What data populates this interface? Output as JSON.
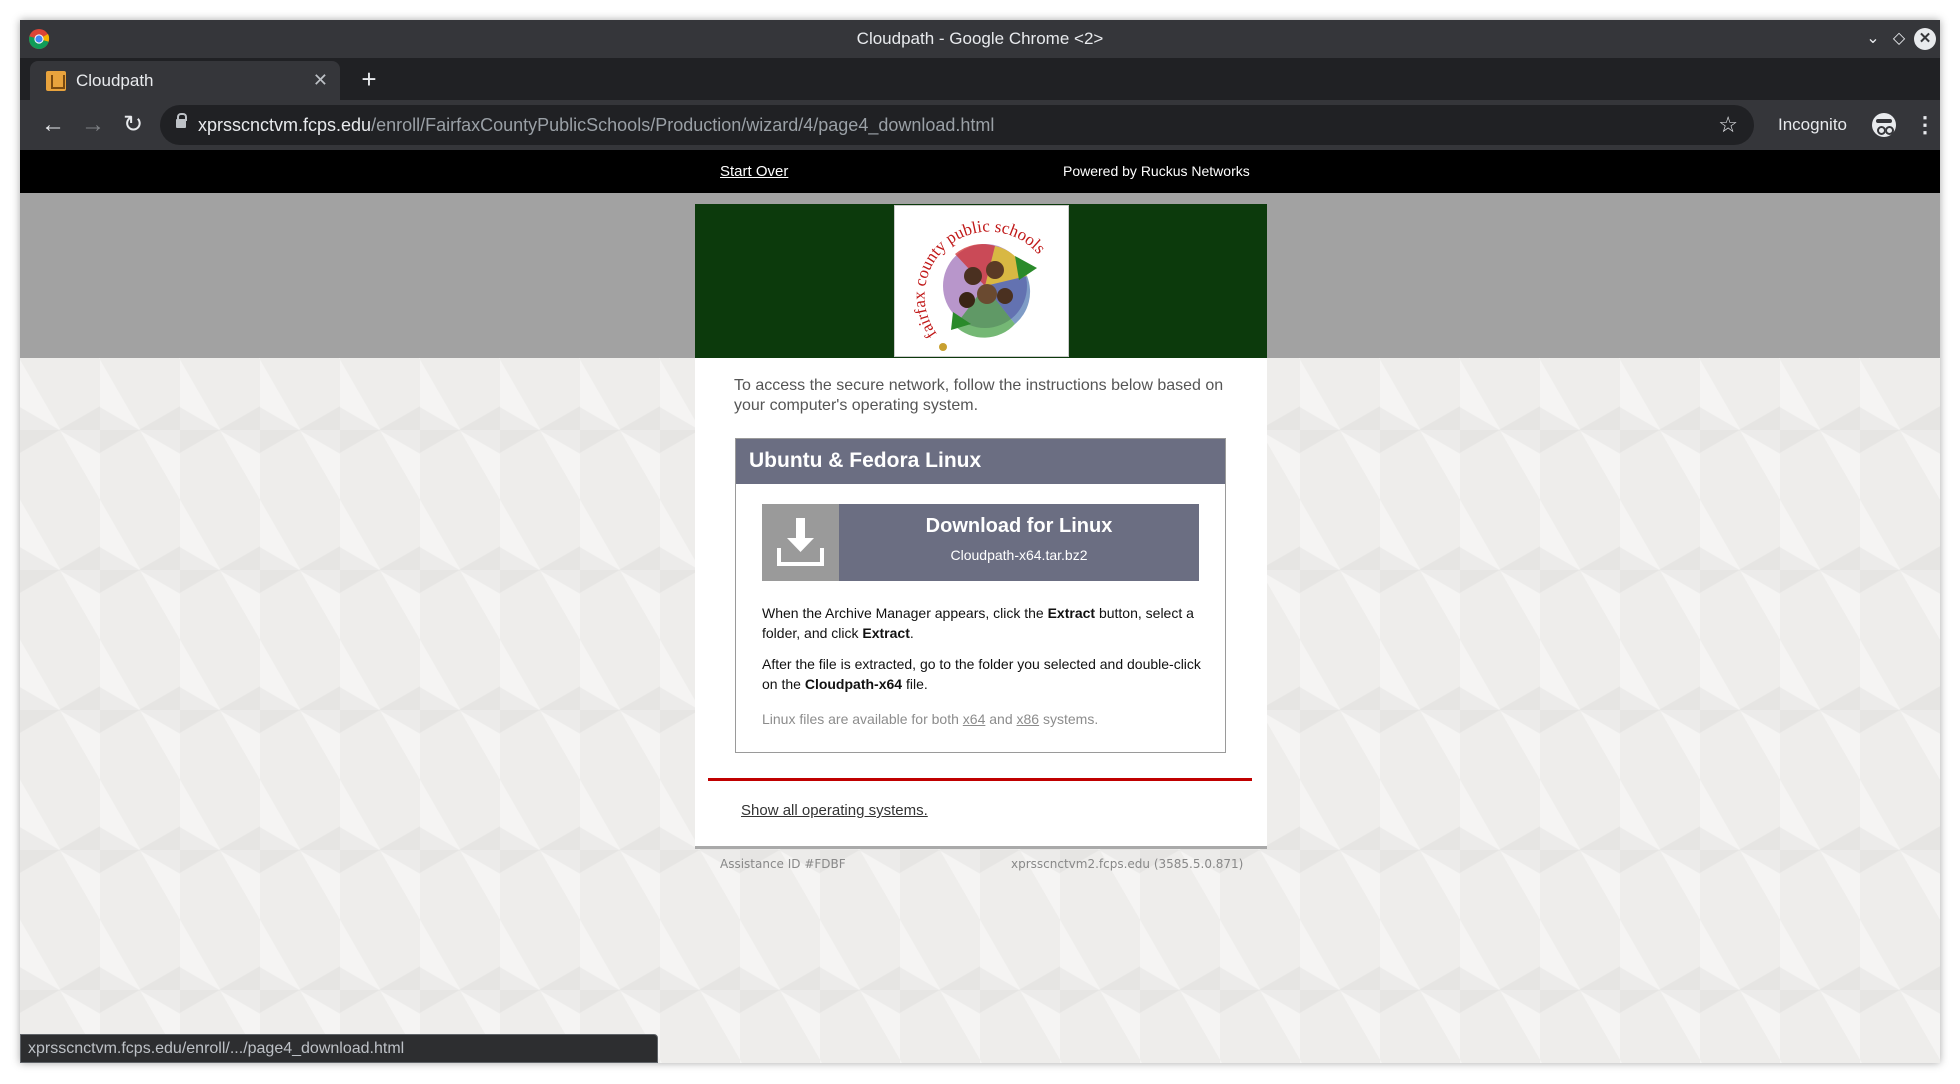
{
  "window": {
    "title": "Cloudpath - Google Chrome <2>"
  },
  "tab": {
    "title": "Cloudpath",
    "close_glyph": "✕",
    "new_tab_glyph": "+"
  },
  "toolbar": {
    "back_glyph": "←",
    "forward_glyph": "→",
    "reload_glyph": "↻",
    "url_host": "xprsscnctvm.fcps.edu",
    "url_path": "/enroll/FairfaxCountyPublicSchools/Production/wizard/4/page4_download.html",
    "star_glyph": "☆",
    "incognito_label": "Incognito",
    "menu_glyph": "⋮"
  },
  "topbar": {
    "start_over": "Start Over",
    "powered_by": "Powered by Ruckus Networks"
  },
  "content": {
    "intro": "To access the secure network, follow the instructions below based on your computer's operating system.",
    "os_title": "Ubuntu & Fedora Linux",
    "download_label": "Download for Linux",
    "download_file": "Cloudpath-x64.tar.bz2",
    "instr1_a": "When the Archive Manager appears, click the ",
    "instr1_b": "Extract",
    "instr1_c": " button, select a folder, and click ",
    "instr1_d": "Extract",
    "instr1_e": ".",
    "instr2_a": "After the file is extracted, go to the folder you selected and double-click on the ",
    "instr2_b": "Cloudpath-x64",
    "instr2_c": " file.",
    "note_a": "Linux files are available for both ",
    "note_x64": "x64",
    "note_b": " and ",
    "note_x86": "x86",
    "note_c": " systems.",
    "show_all": "Show all operating systems."
  },
  "footer": {
    "assistance_id": "Assistance ID #FDBF",
    "server": "xprsscnctvm2.fcps.edu (3585.5.0.871)"
  },
  "status_bar": {
    "url": "xprsscnctvm.fcps.edu/enroll/.../page4_download.html"
  },
  "colors": {
    "banner_green": "#0c3a0c",
    "os_header": "#6b6e82",
    "divider_red": "#c00000"
  },
  "icons": {
    "logo": "fairfax-county-public-schools-logo",
    "download": "download-icon"
  }
}
